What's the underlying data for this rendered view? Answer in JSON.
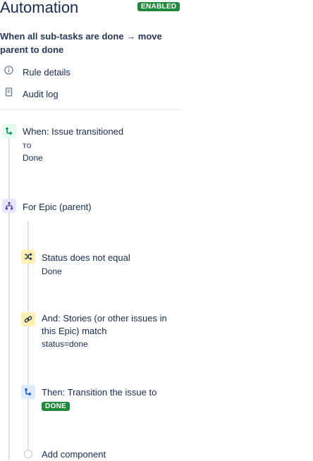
{
  "header": {
    "title": "Automation",
    "status_badge": "ENABLED"
  },
  "rule": {
    "name": "When all sub-tasks are done → move parent to done"
  },
  "sidebar": {
    "items": [
      {
        "label": "Rule details",
        "icon": "info-icon"
      },
      {
        "label": "Audit log",
        "icon": "document-icon"
      }
    ]
  },
  "trigger": {
    "label": "When: Issue transitioned",
    "to_label": "TO",
    "to_value": "Done"
  },
  "branch": {
    "label": "For Epic (parent)"
  },
  "components": [
    {
      "type": "condition",
      "label": "Status does not equal",
      "detail": "Done"
    },
    {
      "type": "condition",
      "label": "And: Stories (or other issues in this Epic) match",
      "detail": "status=done"
    },
    {
      "type": "action",
      "label": "Then: Transition the issue to",
      "badge": "DONE"
    }
  ],
  "add_component": {
    "label": "Add component"
  },
  "colors": {
    "badge_green": "#1f8a3b",
    "trigger_bg": "#e3fcef",
    "branch_bg": "#eae6ff",
    "condition_bg": "#fff0b3",
    "action_bg": "#deebff"
  }
}
